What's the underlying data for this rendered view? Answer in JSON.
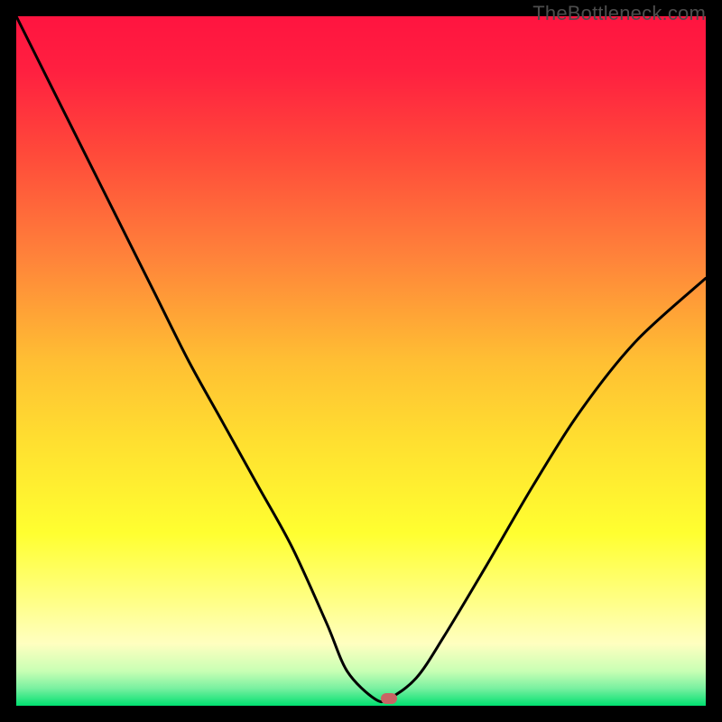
{
  "watermark": "TheBottleneck.com",
  "marker_color": "#c86464",
  "chart_data": {
    "type": "line",
    "title": "",
    "xlabel": "",
    "ylabel": "",
    "xlim": [
      0,
      100
    ],
    "ylim": [
      0,
      100
    ],
    "background_gradient": {
      "stops": [
        {
          "offset": 0.0,
          "color": "#ff1440"
        },
        {
          "offset": 0.08,
          "color": "#ff2040"
        },
        {
          "offset": 0.2,
          "color": "#ff4a3a"
        },
        {
          "offset": 0.35,
          "color": "#ff833a"
        },
        {
          "offset": 0.5,
          "color": "#ffbf33"
        },
        {
          "offset": 0.62,
          "color": "#ffe030"
        },
        {
          "offset": 0.75,
          "color": "#ffff30"
        },
        {
          "offset": 0.85,
          "color": "#ffff88"
        },
        {
          "offset": 0.91,
          "color": "#ffffc0"
        },
        {
          "offset": 0.95,
          "color": "#c8ffb4"
        },
        {
          "offset": 0.975,
          "color": "#78f0a0"
        },
        {
          "offset": 1.0,
          "color": "#00e070"
        }
      ]
    },
    "series": [
      {
        "name": "bottleneck-curve",
        "color": "#000000",
        "x": [
          0,
          5,
          10,
          15,
          20,
          25,
          30,
          35,
          40,
          45,
          48,
          52,
          54,
          58,
          62,
          68,
          75,
          82,
          90,
          100
        ],
        "y": [
          100,
          90,
          80,
          70,
          60,
          50,
          41,
          32,
          23,
          12,
          5,
          1,
          1,
          4,
          10,
          20,
          32,
          43,
          53,
          62
        ]
      }
    ],
    "flat_segment": {
      "x0": 48,
      "x1": 54,
      "y": 1
    },
    "marker": {
      "x": 54,
      "y": 1
    }
  }
}
